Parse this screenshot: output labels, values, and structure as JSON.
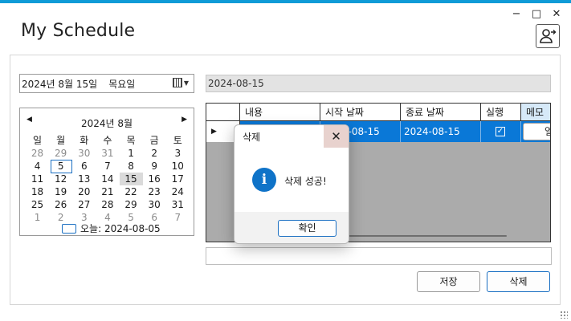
{
  "window": {
    "title": "My Schedule",
    "controls": {
      "minimize": "−",
      "maximize": "□",
      "close": "✕"
    },
    "accent_color": "#0f9bd7"
  },
  "header": {
    "user_button_icon": "user-add-icon"
  },
  "date_picker": {
    "year_month": "2024년   8월 15일",
    "weekday": "목요일",
    "icon": "calendar-icon"
  },
  "selected_date_text": "2024-08-15",
  "calendar": {
    "title": "2024년 8월",
    "prev": "◀",
    "next": "▶",
    "weekdays": [
      "일",
      "월",
      "화",
      "수",
      "목",
      "금",
      "토"
    ],
    "weeks": [
      [
        "28",
        "29",
        "30",
        "31",
        "1",
        "2",
        "3"
      ],
      [
        "4",
        "5",
        "6",
        "7",
        "8",
        "9",
        "10"
      ],
      [
        "11",
        "12",
        "13",
        "14",
        "15",
        "16",
        "17"
      ],
      [
        "18",
        "19",
        "20",
        "21",
        "22",
        "23",
        "24"
      ],
      [
        "25",
        "26",
        "27",
        "28",
        "29",
        "30",
        "31"
      ],
      [
        "1",
        "2",
        "3",
        "4",
        "5",
        "6",
        "7"
      ]
    ],
    "today_label": "오늘: 2024-08-05",
    "today_day": "5",
    "selected_day": "15"
  },
  "grid": {
    "columns": [
      "내용",
      "시작 날짜",
      "종료 날짜",
      "실행",
      "메모"
    ],
    "rows": [
      {
        "content": "",
        "start": "2024-08-15",
        "end": "2024-08-15",
        "done": true,
        "memo_button": "열"
      }
    ],
    "selection_color": "#0a78d7"
  },
  "buttons": {
    "save": "저장",
    "delete": "삭제"
  },
  "dialog": {
    "title": "삭제",
    "close": "✕",
    "message": "삭제 성공!",
    "ok": "확인",
    "icon": "info-icon"
  }
}
